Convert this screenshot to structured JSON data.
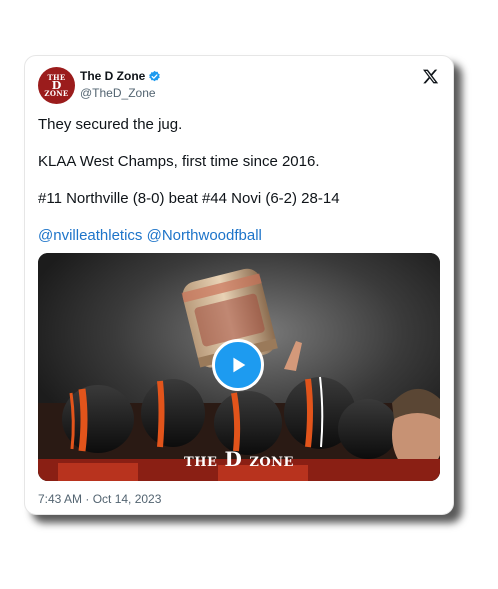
{
  "tweet": {
    "avatar": {
      "line1": "THE",
      "line2": "D",
      "line3": "ZONE"
    },
    "display_name": "The D Zone",
    "handle": "@TheD_Zone",
    "lines": [
      "They secured the jug.",
      "KLAA West Champs, first time since 2016.",
      "#11 Northville (8-0) beat #44 Novi (6-2) 28-14"
    ],
    "mentions": "@nvilleathletics @Northwoodfball",
    "timestamp": "7:43 AM · Oct 14, 2023"
  },
  "media": {
    "watermark_left": "THE",
    "watermark_d": "D",
    "watermark_right": "ZONE"
  },
  "colors": {
    "link": "#1d74c9",
    "verified": "#1d9bf0",
    "play_button": "#1d9bf0",
    "avatar_bg": "#9b1c1c"
  },
  "icons": [
    "x-logo-icon",
    "verified-badge-icon",
    "play-icon"
  ]
}
